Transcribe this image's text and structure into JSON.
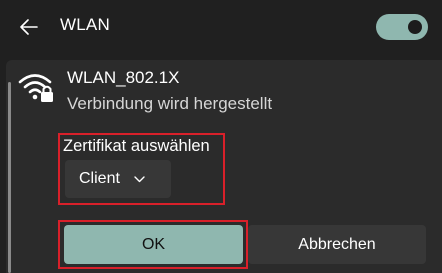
{
  "header": {
    "back_icon": "arrow-left-icon",
    "title": "WLAN",
    "toggle_on": true,
    "accent_color": "#8fb7af"
  },
  "network": {
    "icon": "wifi-secured-icon",
    "name": "WLAN_802.1X",
    "status": "Verbindung wird hergestellt"
  },
  "certificate": {
    "label": "Zertifikat auswählen",
    "selected": "Client",
    "dropdown_icon": "chevron-down-icon"
  },
  "actions": {
    "ok_label": "OK",
    "cancel_label": "Abbrechen"
  },
  "highlight_color": "#d9202a"
}
